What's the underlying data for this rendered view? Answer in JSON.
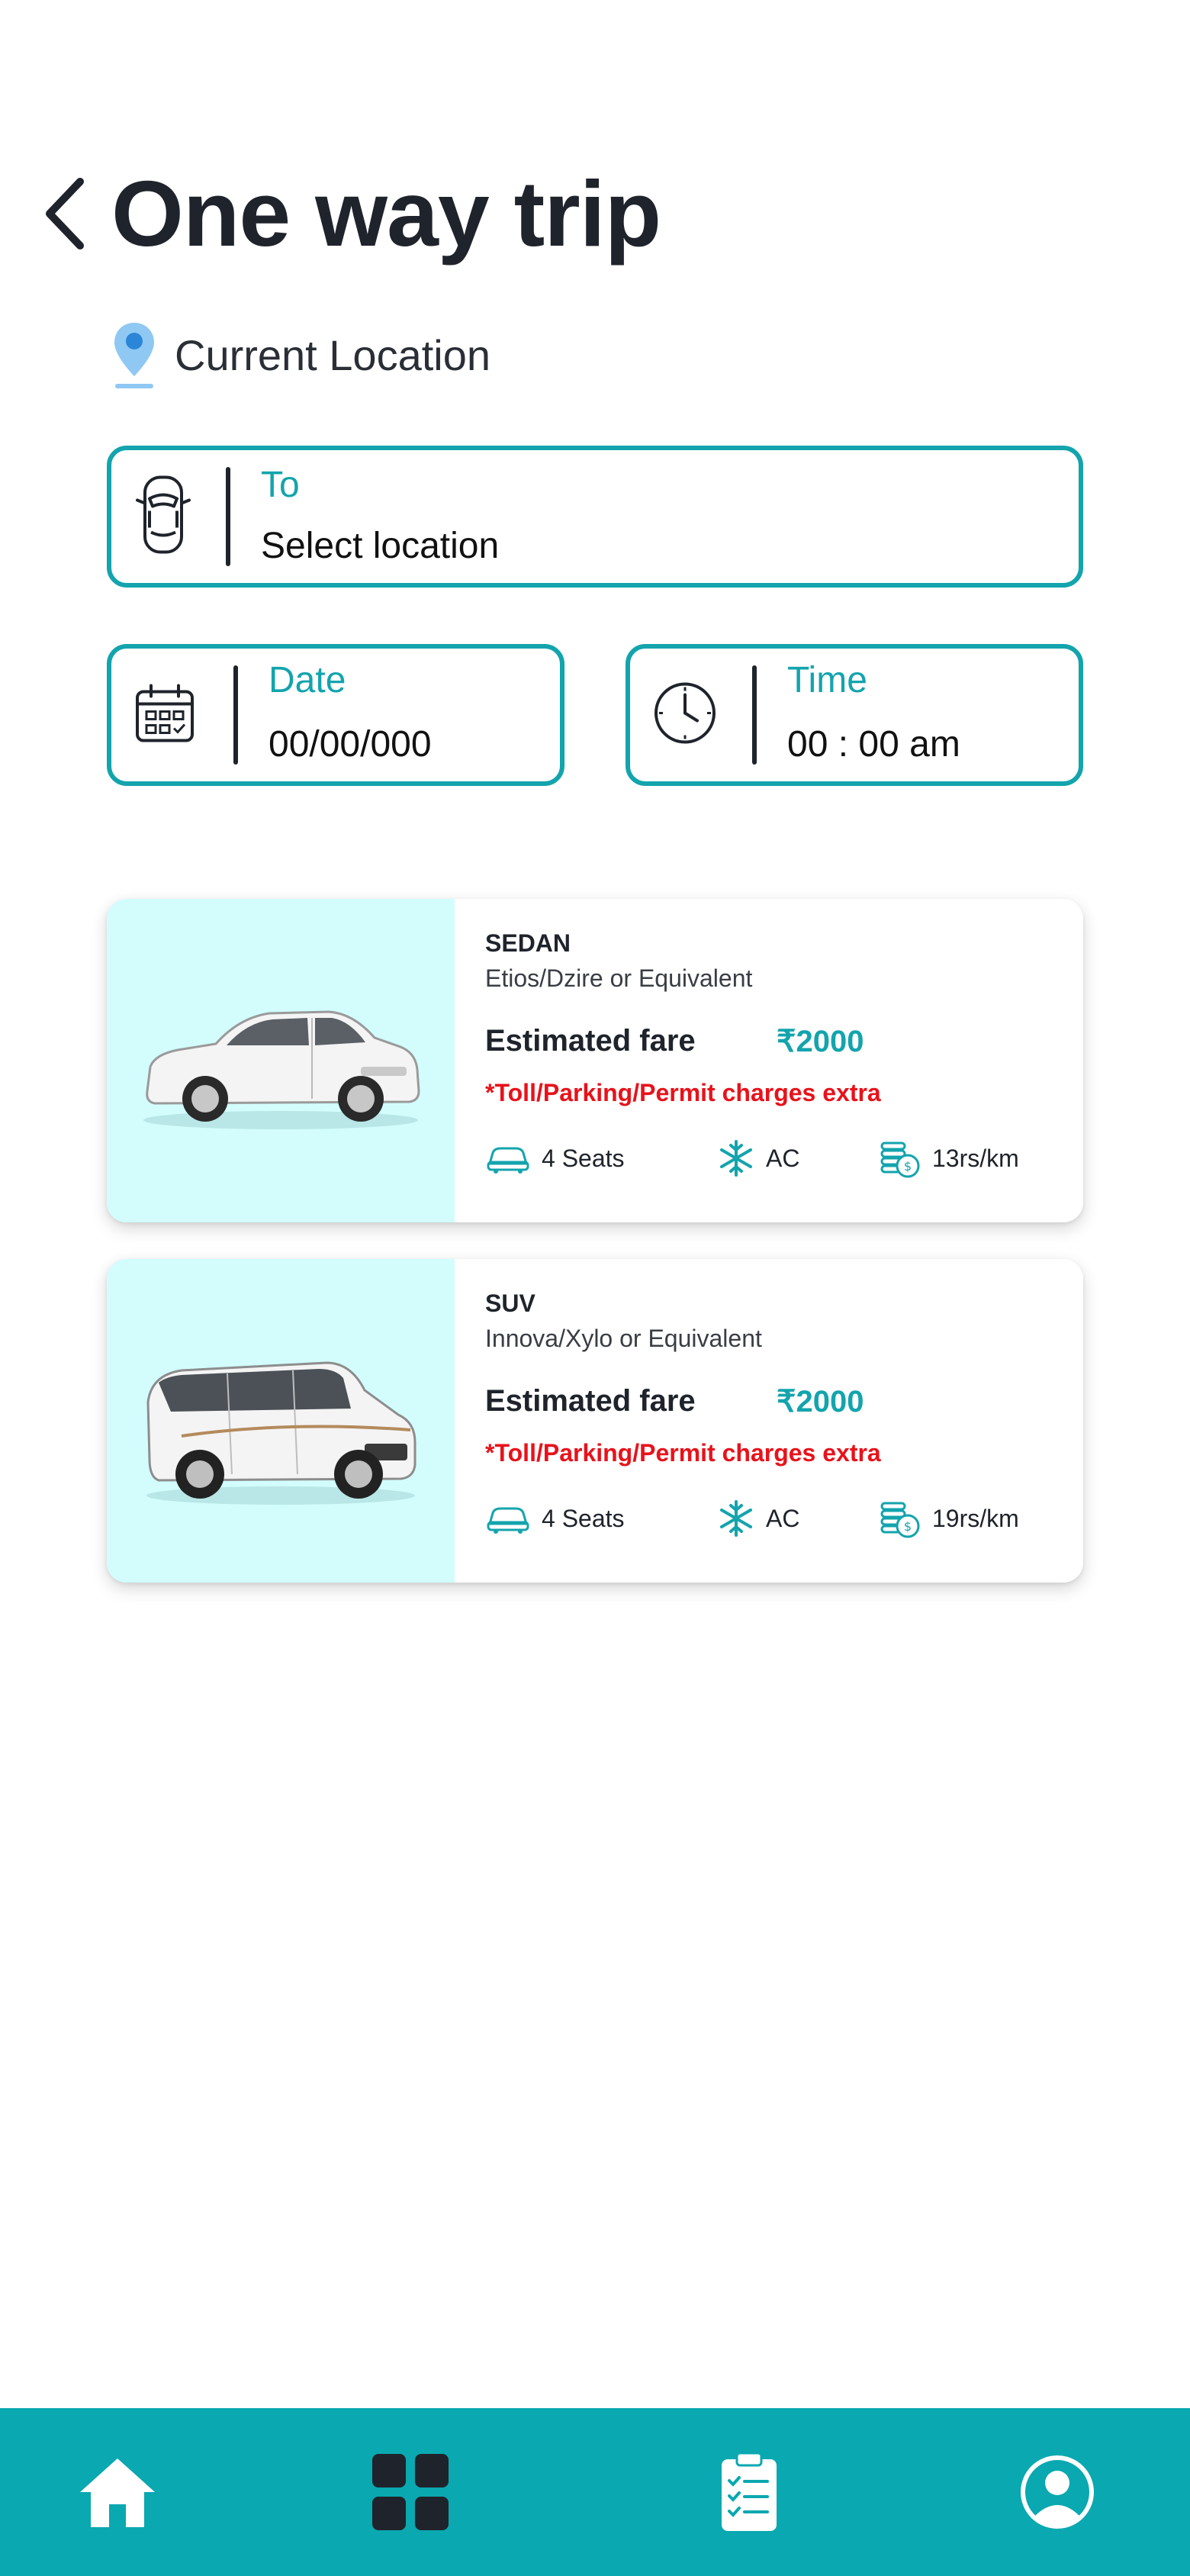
{
  "header": {
    "title": "One way trip",
    "back_icon": "chevron-left-icon"
  },
  "current_location": {
    "label": "Current Location",
    "icon": "map-pin-icon"
  },
  "to_field": {
    "label": "To",
    "value": "Select location",
    "icon": "car-top-icon"
  },
  "date_field": {
    "label": "Date",
    "value": "00/00/000",
    "icon": "calendar-icon"
  },
  "time_field": {
    "label": "Time",
    "value": "00 : 00 am",
    "icon": "clock-icon"
  },
  "cars": [
    {
      "category": "SEDAN",
      "model": "Etios/Dzire or Equivalent",
      "fare_label": "Estimated fare",
      "fare": "₹2000",
      "note": "*Toll/Parking/Permit charges extra",
      "seats": "4 Seats",
      "ac": "AC",
      "rate": "13rs/km"
    },
    {
      "category": "SUV",
      "model": "Innova/Xylo or Equivalent",
      "fare_label": "Estimated fare",
      "fare": "₹2000",
      "note": "*Toll/Parking/Permit charges extra",
      "seats": "4 Seats",
      "ac": "AC",
      "rate": "19rs/km"
    }
  ],
  "bottom_nav": {
    "items": [
      "home-icon",
      "grid-icon",
      "clipboard-list-icon",
      "user-circle-icon"
    ]
  },
  "colors": {
    "accent": "#13a4ad",
    "nav_bg": "#0aa8b0",
    "image_panel_bg": "#d3fdfd",
    "warning_red": "#e8121b",
    "text_dark": "#1f232b"
  }
}
